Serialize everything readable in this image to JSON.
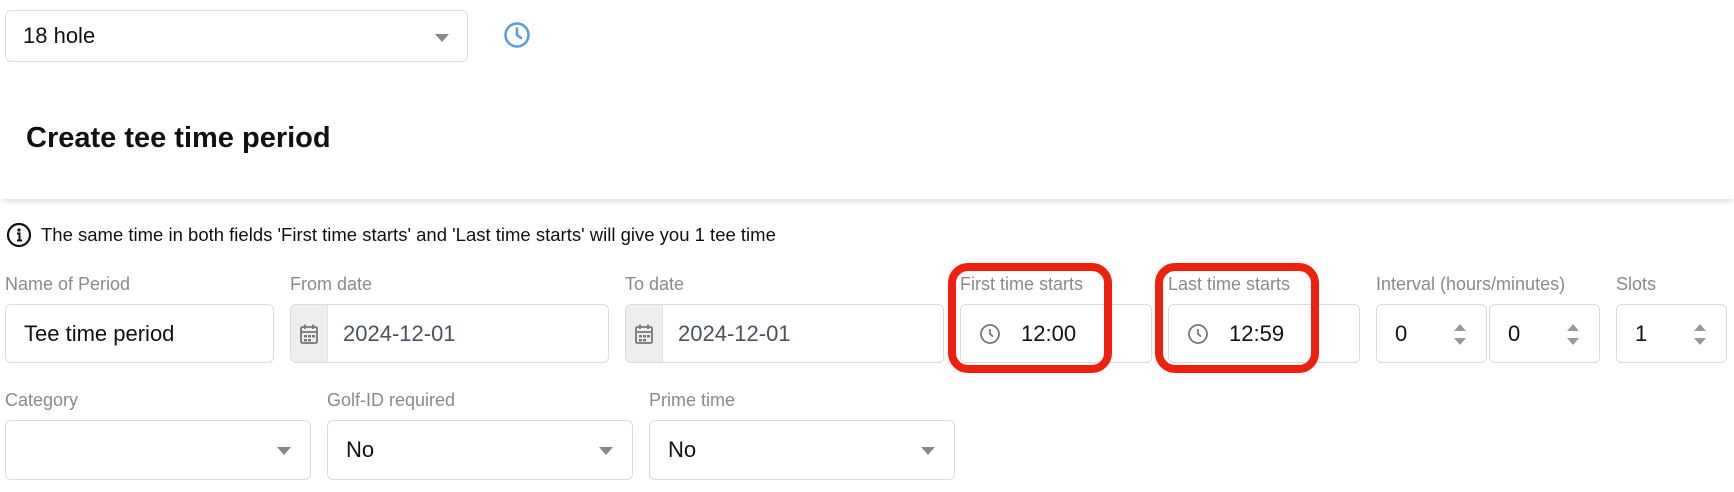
{
  "course_select": {
    "value": "18 hole"
  },
  "page_title": "Create tee time period",
  "info_text": "The same time in both fields 'First time starts' and 'Last time starts' will give you 1 tee time",
  "fields": {
    "name_label": "Name of Period",
    "name_value": "Tee time period",
    "from_label": "From date",
    "from_value": "2024-12-01",
    "to_label": "To date",
    "to_value": "2024-12-01",
    "first_label": "First time starts",
    "first_value": "12:00",
    "last_label": "Last time starts",
    "last_value": "12:59",
    "interval_label": "Interval (hours/minutes)",
    "interval_hours": "0",
    "interval_minutes": "0",
    "slots_label": "Slots",
    "slots_value": "1",
    "category_label": "Category",
    "category_value": "",
    "golfid_label": "Golf-ID required",
    "golfid_value": "No",
    "prime_label": "Prime time",
    "prime_value": "No"
  },
  "icons": [
    "clock-icon",
    "info-icon",
    "calendar-icon",
    "chevron-down-icon"
  ],
  "colors": {
    "accent": "#5a9ae0",
    "highlight": "#f0200e",
    "header_shadow": "#d9d9d9"
  }
}
